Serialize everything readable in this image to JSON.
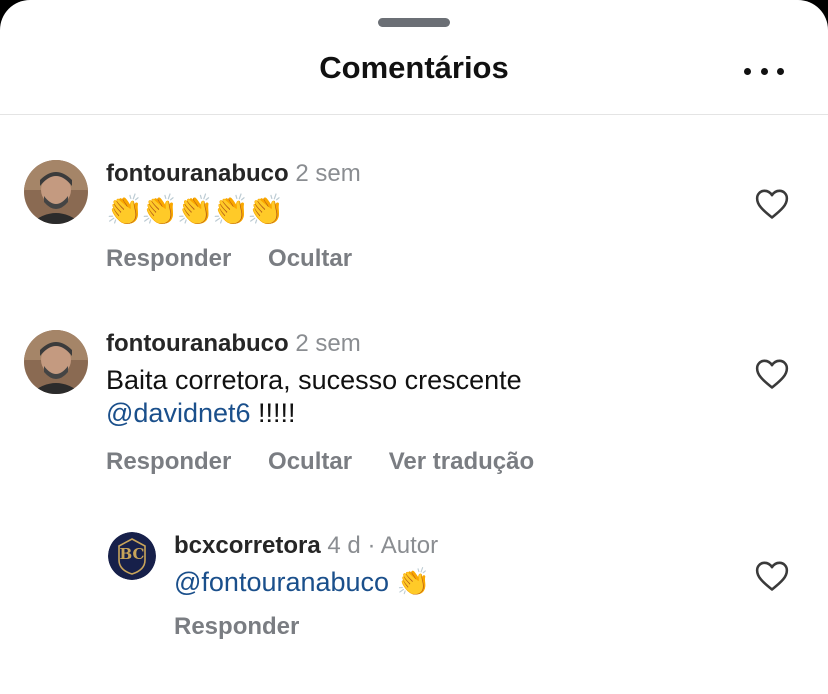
{
  "header": {
    "title": "Comentários",
    "more_icon": "more-horizontal-icon"
  },
  "comments": [
    {
      "username": "fontouranabuco",
      "time": "2 sem",
      "text": "👏👏👏👏👏",
      "actions": [
        "Responder",
        "Ocultar"
      ],
      "like_icon": "heart-outline-icon"
    },
    {
      "username": "fontouranabuco",
      "time": "2 sem",
      "text_line1": "Baita corretora, sucesso crescente",
      "mention": "@davidnet6",
      "text_after_mention": " !!!!!",
      "actions": [
        "Responder",
        "Ocultar",
        "Ver tradução"
      ],
      "like_icon": "heart-outline-icon"
    }
  ],
  "reply": {
    "username": "bcxcorretora",
    "time": "4 d · Autor",
    "mention": "@fontouranabuco",
    "text_after_mention": " 👏",
    "actions": [
      "Responder"
    ],
    "avatar_logo_text": "BC",
    "like_icon": "heart-outline-icon"
  },
  "colors": {
    "mention": "#1a4f8b",
    "meta": "#8a8d91",
    "action": "#7a7d82"
  }
}
